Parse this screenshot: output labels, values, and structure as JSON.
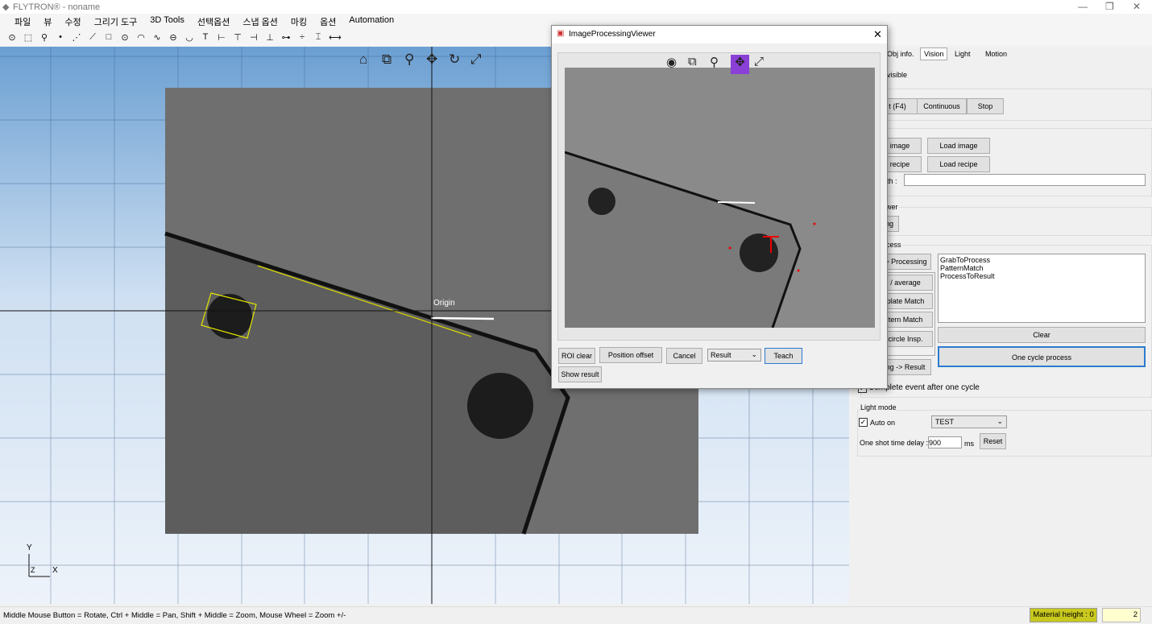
{
  "window": {
    "title": "FLYTRON® - noname",
    "controls": [
      "—",
      "❐",
      "✕"
    ]
  },
  "menu": [
    "파일",
    "뷰",
    "수정",
    "그리기 도구",
    "3D Tools",
    "선택옵션",
    "스냅 옵션",
    "마킹",
    "옵션",
    "Automation"
  ],
  "toolbar_icons": [
    "⊙",
    "⬚",
    "⚲",
    "•",
    "⋰",
    "⟋",
    "□",
    "⊙",
    "◠",
    "∿",
    "⊖",
    "◡",
    "T",
    "⊢",
    "⊤",
    "⊣",
    "⊥",
    "⊶",
    "÷",
    "⌶",
    "⟷"
  ],
  "viewport": {
    "origin_label": "Origin",
    "axis_y": "Y",
    "axis_x": "X",
    "axis_z": "Z",
    "view_icons": [
      "home-icon",
      "zoom-window-icon",
      "zoom-icon",
      "pan-icon",
      "rotate-icon",
      "fit-icon"
    ]
  },
  "dialog": {
    "title": "ImageProcessingViewer",
    "close": "✕",
    "buttons": {
      "roi_clear": "ROI clear",
      "position_offset": "Position offset",
      "cancel": "Cancel",
      "teach": "Teach",
      "show_result": "Show result"
    },
    "select_value": "Result",
    "active_tool_color": "#8a3fd6"
  },
  "panel": {
    "tabs": [
      "Obj info.",
      "Vision",
      "Light",
      "Motion"
    ],
    "active_tab": "Vision",
    "visible_label": "visible",
    "grab": {
      "btn1": "t (F4)",
      "continuous": "Continuous",
      "stop": "Stop"
    },
    "file": {
      "save_image": "image",
      "load_image": "Load image",
      "save_recipe": "recipe",
      "load_recipe": "Load recipe",
      "path_label": "th :",
      "path_value": ""
    },
    "viewer": {
      "title": "wer",
      "btn": "ing"
    },
    "process": {
      "title": "cess",
      "grab_to_processing": "-> Processing",
      "average": "/ average",
      "template_match": "plate Match",
      "pattern_match": "tern Match",
      "circle_insp": "circle Insp.",
      "processing_to_result": "ing -> Result",
      "list": [
        "GrabToProcess",
        "PatternMatch",
        "ProcessToResult"
      ],
      "clear": "Clear",
      "one_cycle": "One cycle process",
      "complete_event": "Complete event after one cycle"
    },
    "light": {
      "title": "Light mode",
      "auto_on": "Auto on",
      "mode": "TEST",
      "delay_label": "One shot time delay :",
      "delay_value": "900",
      "unit": "ms",
      "reset": "Reset"
    }
  },
  "status": {
    "hint": "Middle Mouse Button = Rotate, Ctrl + Middle = Pan, Shift + Middle = Zoom, Mouse Wheel = Zoom +/-",
    "material_height": "Material height : 0",
    "value": "2"
  }
}
